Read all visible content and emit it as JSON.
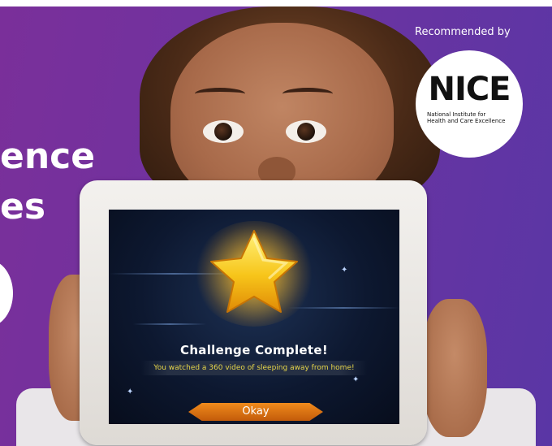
{
  "headline": {
    "line1": "ence",
    "line2": "es"
  },
  "badge": {
    "recommended_label": "Recommended by",
    "logo_text": "NICE",
    "logo_subtext_line1": "National Institute for",
    "logo_subtext_line2": "Health and Care Excellence"
  },
  "tablet_screen": {
    "title": "Challenge Complete!",
    "message": "You watched a 360 video of sleeping away from home!",
    "button_label": "Okay"
  },
  "colors": {
    "banner_purple": "#6e33a0",
    "message_yellow": "#e7d64a",
    "button_orange": "#f08b1c",
    "star_gold": "#f7c51a"
  },
  "icons": {
    "star": "star-icon"
  }
}
